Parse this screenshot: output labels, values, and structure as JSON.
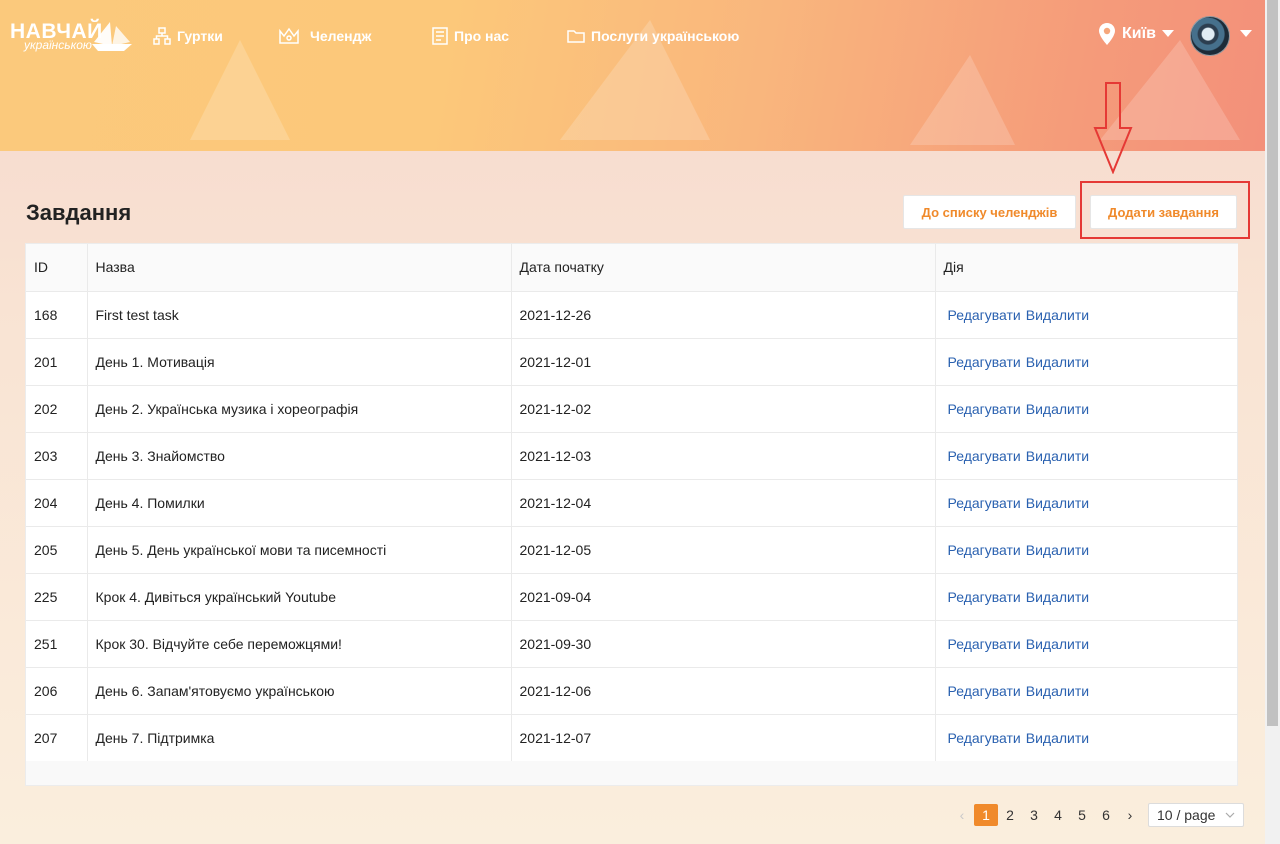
{
  "header": {
    "logo_top": "НАВЧАЙ",
    "logo_bottom": "українською",
    "nav": [
      {
        "label": "Гуртки",
        "icon": "network-icon"
      },
      {
        "label": "Челендж",
        "icon": "crown-icon"
      },
      {
        "label": "Про нас",
        "icon": "document-icon"
      },
      {
        "label": "Послуги українською",
        "icon": "folder-icon"
      }
    ],
    "city": "Київ"
  },
  "page": {
    "title": "Завдання",
    "btn_list": "До списку челенджів",
    "btn_add": "Додати завдання"
  },
  "table": {
    "columns": [
      "ID",
      "Назва",
      "Дата початку",
      "Дія"
    ],
    "rows": [
      {
        "id": "168",
        "name": "First test task",
        "date": "2021-12-26"
      },
      {
        "id": "201",
        "name": "День 1. Мотивація",
        "date": "2021-12-01"
      },
      {
        "id": "202",
        "name": "День 2. Українська музика і хореографія",
        "date": "2021-12-02"
      },
      {
        "id": "203",
        "name": "День 3. Знайомство",
        "date": "2021-12-03"
      },
      {
        "id": "204",
        "name": "День 4. Помилки",
        "date": "2021-12-04"
      },
      {
        "id": "205",
        "name": "День 5. День української мови та писемності",
        "date": "2021-12-05"
      },
      {
        "id": "225",
        "name": "Крок 4. Дивіться український Youtube",
        "date": "2021-09-04"
      },
      {
        "id": "251",
        "name": "Крок 30. Відчуйте себе переможцями!",
        "date": "2021-09-30"
      },
      {
        "id": "206",
        "name": "День 6. Запам'ятовуємо українською",
        "date": "2021-12-06"
      },
      {
        "id": "207",
        "name": "День 7. Підтримка",
        "date": "2021-12-07"
      }
    ],
    "edit_label": "Редагувати",
    "delete_label": "Видалити"
  },
  "pagination": {
    "pages": [
      "1",
      "2",
      "3",
      "4",
      "5",
      "6"
    ],
    "current": "1",
    "page_size": "10 / page"
  },
  "colors": {
    "accent": "#f08a2b",
    "link": "#2a61b0",
    "annotation": "#e53935"
  }
}
